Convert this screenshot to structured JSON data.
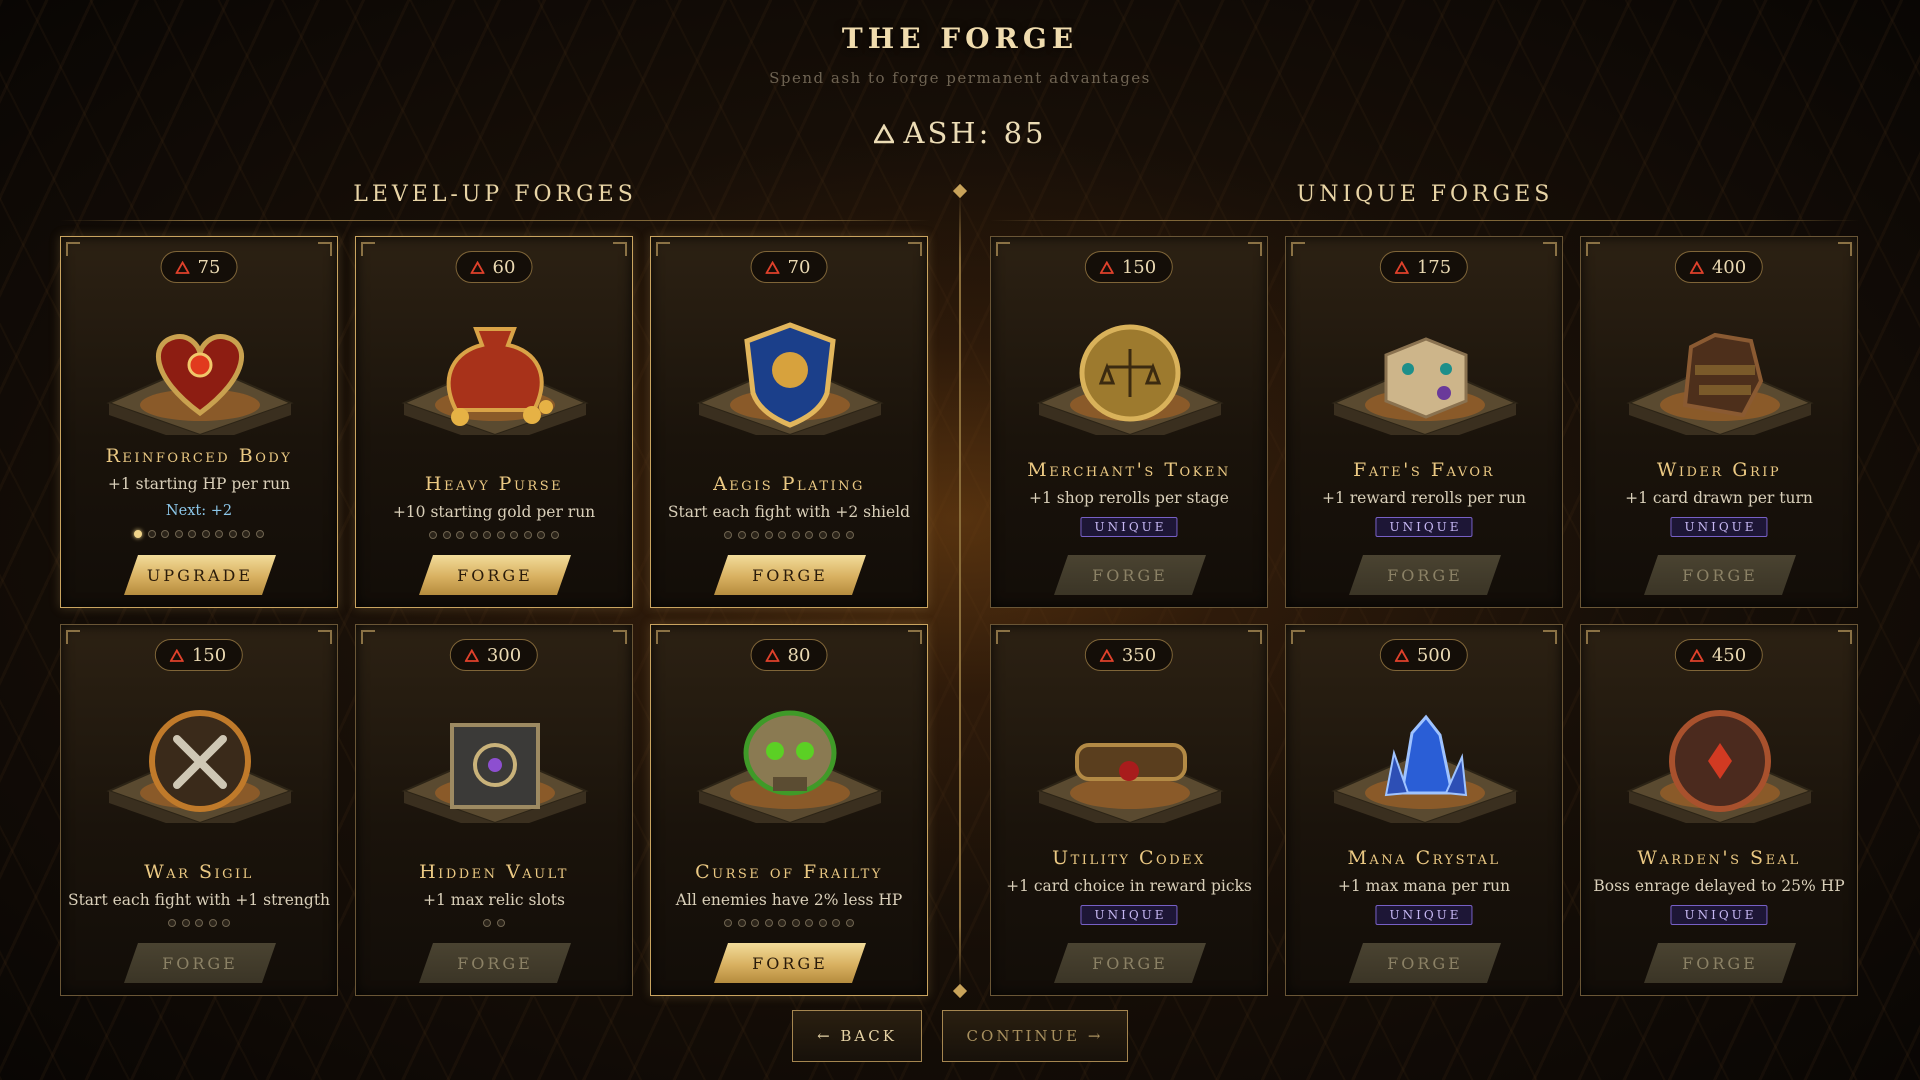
{
  "header": {
    "title": "THE FORGE",
    "subtitle": "Spend ash to forge permanent advantages",
    "ash_label": "ASH: 85"
  },
  "sections": {
    "level_up_title": "LEVEL-UP FORGES",
    "unique_title": "UNIQUE FORGES"
  },
  "colors": {
    "accent_gold": "#ebc983",
    "cost_triangle": "#e0412b",
    "unique_badge": "#7760c6",
    "next_text": "#8cc7ea"
  },
  "cards": [
    {
      "cost": "75",
      "name": "Reinforced Body",
      "desc": "+1 starting HP per run",
      "next": "Next: +2",
      "pips_total": 10,
      "pips_filled": 1,
      "button": "UPGRADE",
      "button_enabled": true,
      "icon": "heart-icon",
      "unique": false
    },
    {
      "cost": "60",
      "name": "Heavy Purse",
      "desc": "+10 starting gold per run",
      "pips_total": 10,
      "pips_filled": 0,
      "button": "FORGE",
      "button_enabled": true,
      "icon": "coin-bag-icon",
      "unique": false
    },
    {
      "cost": "70",
      "name": "Aegis Plating",
      "desc": "Start each fight with +2 shield",
      "pips_total": 10,
      "pips_filled": 0,
      "button": "FORGE",
      "button_enabled": true,
      "icon": "shield-icon",
      "unique": false
    },
    {
      "cost": "150",
      "name": "Merchant's Token",
      "desc": "+1 shop rerolls per stage",
      "badge": "UNIQUE",
      "button": "FORGE",
      "button_enabled": false,
      "icon": "scales-coin-icon",
      "unique": true
    },
    {
      "cost": "175",
      "name": "Fate's Favor",
      "desc": "+1 reward rerolls per run",
      "badge": "UNIQUE",
      "button": "FORGE",
      "button_enabled": false,
      "icon": "dice-icon",
      "unique": true
    },
    {
      "cost": "400",
      "name": "Wider Grip",
      "desc": "+1 card drawn per turn",
      "badge": "UNIQUE",
      "button": "FORGE",
      "button_enabled": false,
      "icon": "gauntlet-icon",
      "unique": true
    },
    {
      "cost": "150",
      "name": "War Sigil",
      "desc": "Start each fight with +1 strength",
      "pips_total": 5,
      "pips_filled": 0,
      "button": "FORGE",
      "button_enabled": false,
      "icon": "crossed-axes-icon",
      "unique": false
    },
    {
      "cost": "300",
      "name": "Hidden Vault",
      "desc": "+1 max relic slots",
      "pips_total": 2,
      "pips_filled": 0,
      "button": "FORGE",
      "button_enabled": false,
      "icon": "vault-icon",
      "unique": false
    },
    {
      "cost": "80",
      "name": "Curse of Frailty",
      "desc": "All enemies have 2% less HP",
      "pips_total": 10,
      "pips_filled": 0,
      "button": "FORGE",
      "button_enabled": true,
      "icon": "cursed-skull-icon",
      "unique": false
    },
    {
      "cost": "350",
      "name": "Utility Codex",
      "desc": "+1 card choice in reward picks",
      "badge": "UNIQUE",
      "button": "FORGE",
      "button_enabled": false,
      "icon": "scroll-icon",
      "unique": true
    },
    {
      "cost": "500",
      "name": "Mana Crystal",
      "desc": "+1 max mana per run",
      "badge": "UNIQUE",
      "button": "FORGE",
      "button_enabled": false,
      "icon": "crystal-icon",
      "unique": true
    },
    {
      "cost": "450",
      "name": "Warden's Seal",
      "desc": "Boss enrage delayed to 25% HP",
      "badge": "UNIQUE",
      "button": "FORGE",
      "button_enabled": false,
      "icon": "seal-icon",
      "unique": true
    }
  ],
  "footer": {
    "back_label": "← BACK",
    "continue_label": "CONTINUE →"
  }
}
